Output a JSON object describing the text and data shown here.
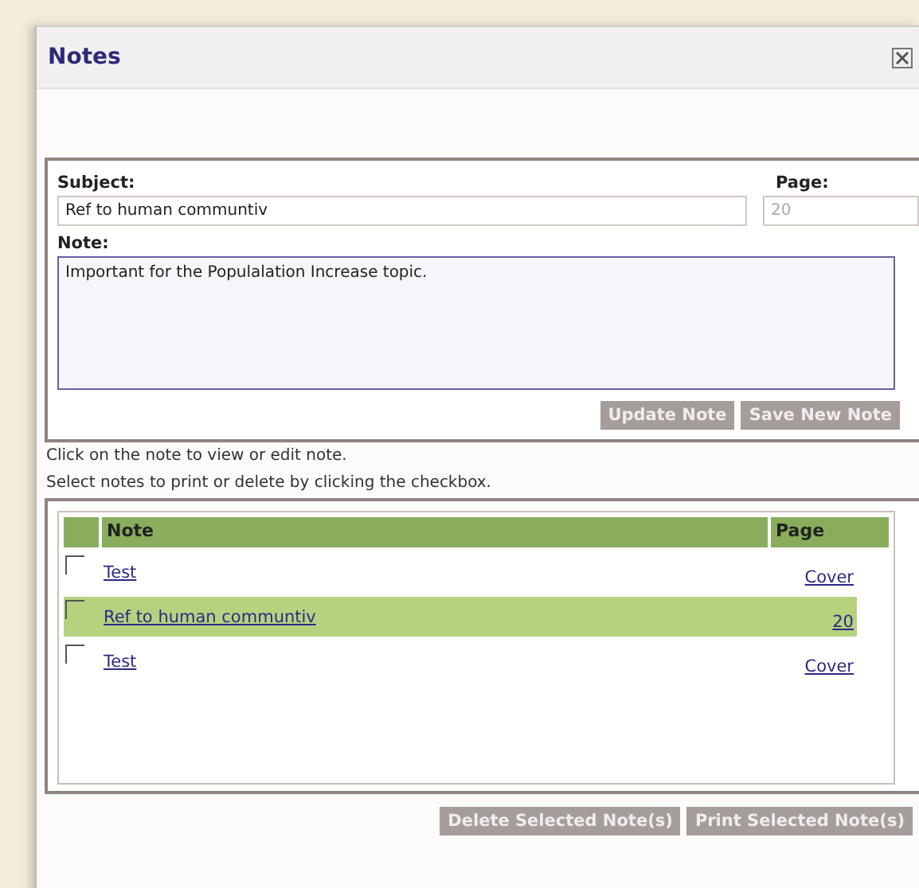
{
  "window": {
    "title": "Notes"
  },
  "form": {
    "subject_label": "Subject:",
    "subject_value": "Ref to human communtiv",
    "page_label": "Page:",
    "page_value": "20",
    "page_disabled": true,
    "note_label": "Note:",
    "note_value": "Important for the Populalation Increase topic.",
    "buttons": [
      {
        "label": "Update Note",
        "disabled": true
      },
      {
        "label": "Save New Note",
        "disabled": true
      }
    ]
  },
  "instructions": [
    "Click on the note to view or edit note.",
    "Select notes to print or delete by clicking the checkbox."
  ],
  "table": {
    "columns": [
      "Note",
      "Page"
    ],
    "rows": [
      {
        "note": "Test",
        "page": "Cover",
        "selected": false,
        "checked": false
      },
      {
        "note": "Ref to human communtiv",
        "page": "20",
        "selected": true,
        "checked": false
      },
      {
        "note": "Test",
        "page": "Cover",
        "selected": false,
        "checked": false
      }
    ]
  },
  "list_buttons": [
    {
      "label": "Delete Selected Note(s)",
      "disabled": true
    },
    {
      "label": "Print Selected Note(s)",
      "disabled": true
    }
  ]
}
